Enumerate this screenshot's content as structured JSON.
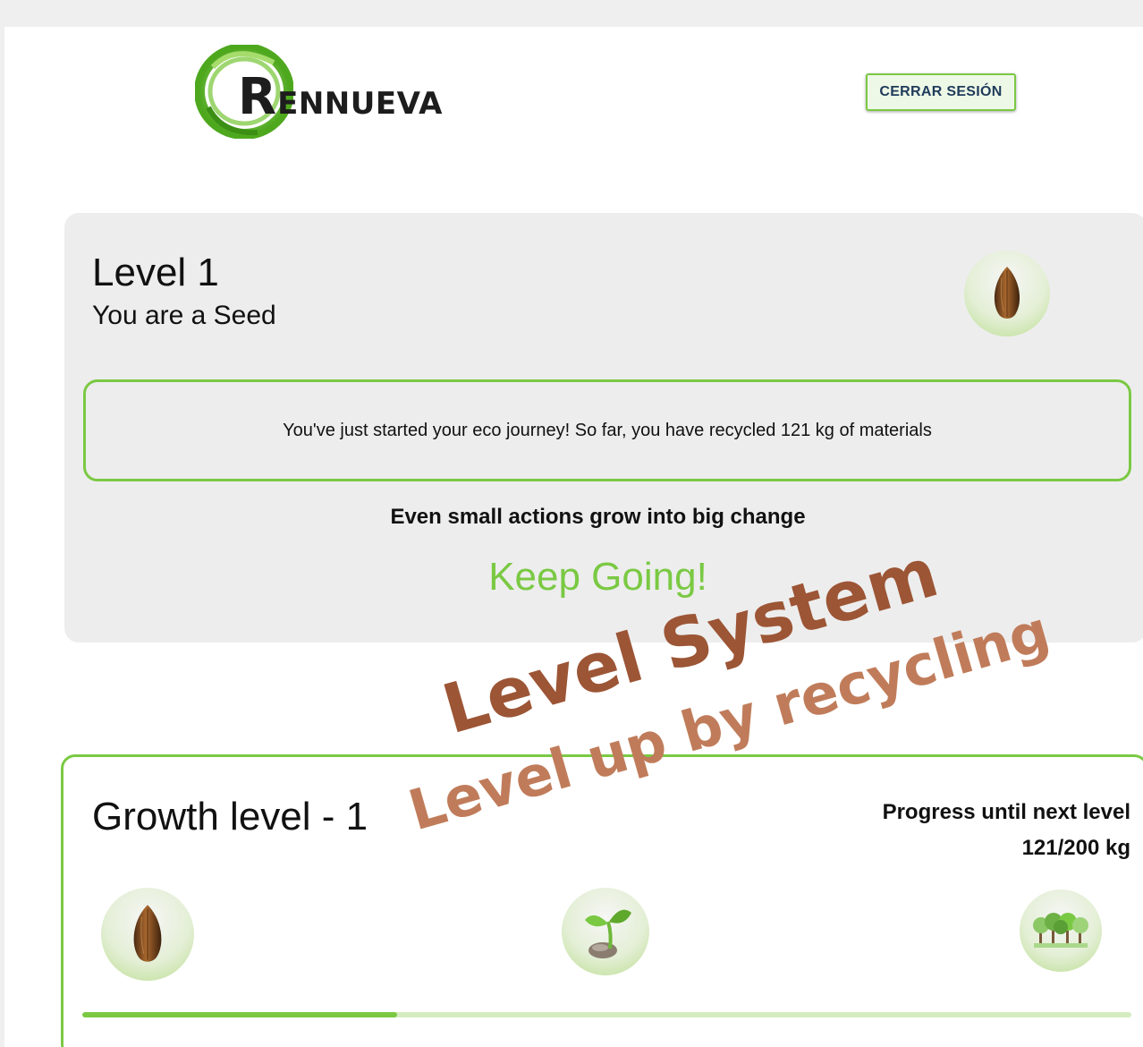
{
  "header": {
    "logo_text_first": "R",
    "logo_text_rest": "ENNUEVA",
    "logout_label": "CERRAR SESIÓN"
  },
  "level_card": {
    "title": "Level 1",
    "subtitle": "You are a Seed",
    "avatar_icon": "seed-icon",
    "message": "You've just started your eco journey! So far, you have recycled 121 kg of materials",
    "motto": "Even small actions grow into big change",
    "encouragement": "Keep Going!"
  },
  "growth_card": {
    "title": "Growth level - 1",
    "progress_label": "Progress until next level",
    "progress_value": "121/200 kg",
    "progress_fraction": 0.3,
    "stages": [
      {
        "icon": "seed-icon"
      },
      {
        "icon": "sprout-icon"
      },
      {
        "icon": "forest-icon"
      }
    ]
  },
  "overlay": {
    "line1": "Level System",
    "line2": "Level up by recycling"
  },
  "colors": {
    "accent_green": "#7ac943",
    "overlay_dark": "#9c5535",
    "overlay_light": "#c07c5a"
  }
}
